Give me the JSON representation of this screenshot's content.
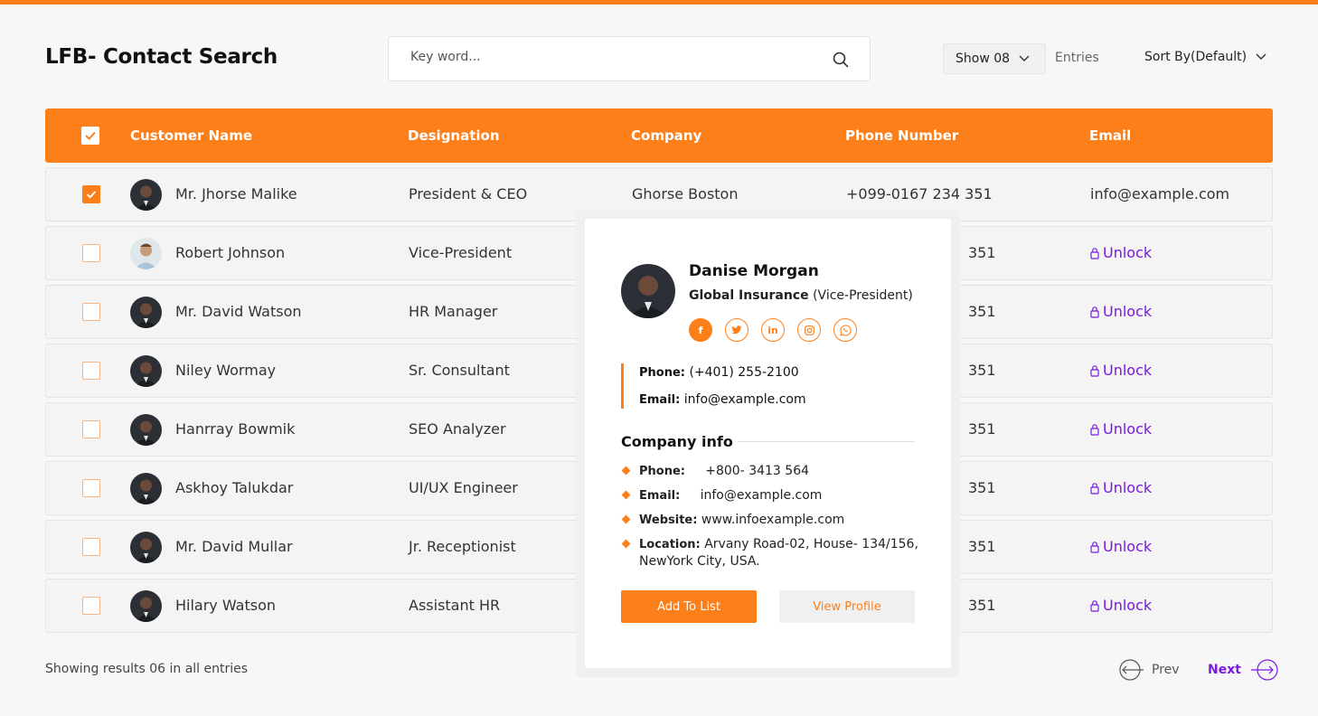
{
  "header": {
    "title": "LFB- Contact Search",
    "search_placeholder": "Key word...",
    "show_label": "Show 08",
    "entries_label": "Entries",
    "sort_label": "Sort By(Default)"
  },
  "table": {
    "columns": [
      "Customer Name",
      "Designation",
      "Company",
      "Phone Number",
      "Email"
    ],
    "rows": [
      {
        "name": "Mr. Jhorse Malike",
        "designation": "President & CEO",
        "company": "Ghorse Boston",
        "phone": "+099-0167 234 351",
        "email": "info@example.com",
        "checked": true
      },
      {
        "name": "Robert Johnson",
        "designation": "Vice-President",
        "phone_tail": "351",
        "unlock": "Unlock",
        "checked": false
      },
      {
        "name": "Mr. David Watson",
        "designation": "HR Manager",
        "phone_tail": "351",
        "unlock": "Unlock",
        "checked": false
      },
      {
        "name": "Niley Wormay",
        "designation": "Sr. Consultant",
        "phone_tail": "351",
        "unlock": "Unlock",
        "checked": false
      },
      {
        "name": "Hanrray Bowmik",
        "designation": "SEO Analyzer",
        "phone_tail": "351",
        "unlock": "Unlock",
        "checked": false
      },
      {
        "name": "Askhoy Talukdar",
        "designation": "UI/UX Engineer",
        "phone_tail": "351",
        "unlock": "Unlock",
        "checked": false
      },
      {
        "name": "Mr. David Mullar",
        "designation": "Jr. Receptionist",
        "phone_tail": "351",
        "unlock": "Unlock",
        "checked": false
      },
      {
        "name": "Hilary Watson",
        "designation": "Assistant HR",
        "phone_tail": "351",
        "unlock": "Unlock",
        "checked": false
      }
    ]
  },
  "footer": {
    "results_text": "Showing results 06 in all entries",
    "prev": "Prev",
    "next": "Next"
  },
  "popup": {
    "name": "Danise Morgan",
    "company": "Global Insurance",
    "role": "(Vice-President)",
    "socials": [
      "facebook-icon",
      "twitter-icon",
      "linkedin-icon",
      "instagram-icon",
      "whatsapp-icon"
    ],
    "phone_key": "Phone:",
    "phone": "(+401) 255-2100",
    "email_key": "Email:",
    "email": "info@example.com",
    "company_info_title": "Company info",
    "company_info": {
      "phone_key": "Phone:",
      "phone": "+800- 3413 564",
      "email_key": "Email:",
      "email": "info@example.com",
      "website_key": "Website:",
      "website": "www.infoexample.com",
      "location_key": "Location:",
      "location": "Arvany Road-02, House- 134/156, NewYork City, USA."
    },
    "add_button": "Add To List",
    "view_button": "View Profile"
  },
  "colors": {
    "accent": "#fd7f1a",
    "unlock": "#7a19e0"
  }
}
